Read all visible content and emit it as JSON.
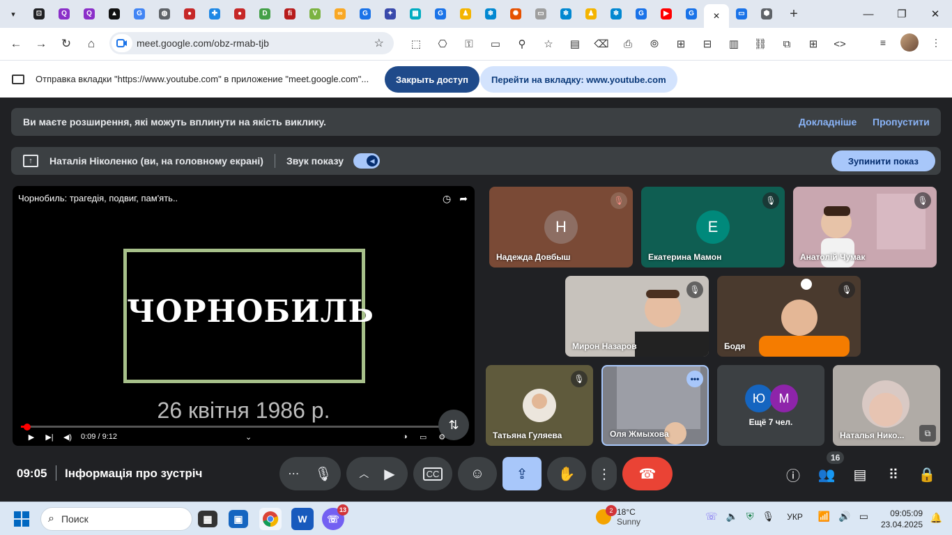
{
  "browser": {
    "tabs": [
      {
        "icon": "google-meet-icon",
        "glyph": "⊡",
        "color": "#202124"
      },
      {
        "icon": "q-icon",
        "glyph": "Q",
        "color": "#8b2fc9"
      },
      {
        "icon": "q-icon",
        "glyph": "Q",
        "color": "#8b2fc9"
      },
      {
        "icon": "delta-icon",
        "glyph": "▲",
        "color": "#111111"
      },
      {
        "icon": "google-icon",
        "glyph": "G",
        "color": "#4285f4"
      },
      {
        "icon": "globe-icon",
        "glyph": "◍",
        "color": "#5f6368"
      },
      {
        "icon": "red-ball-icon",
        "glyph": "●",
        "color": "#c62828"
      },
      {
        "icon": "puzzle-icon",
        "glyph": "✚",
        "color": "#1e88e5"
      },
      {
        "icon": "red-ball-icon",
        "glyph": "●",
        "color": "#c62828"
      },
      {
        "icon": "d-icon",
        "glyph": "D",
        "color": "#43a047"
      },
      {
        "icon": "fi-icon",
        "glyph": "fi",
        "color": "#b71c1c"
      },
      {
        "icon": "ve-icon",
        "glyph": "V",
        "color": "#7cb342"
      },
      {
        "icon": "link-icon",
        "glyph": "∞",
        "color": "#f9a825"
      },
      {
        "icon": "gsuite-icon",
        "glyph": "G",
        "color": "#1a73e8"
      },
      {
        "icon": "badge-icon",
        "glyph": "✦",
        "color": "#3949ab"
      },
      {
        "icon": "grid-icon",
        "glyph": "▦",
        "color": "#00acc1"
      },
      {
        "icon": "gsuite-icon",
        "glyph": "G",
        "color": "#1a73e8"
      },
      {
        "icon": "bell-icon",
        "glyph": "♟",
        "color": "#f4b400"
      },
      {
        "icon": "snowflake-icon",
        "glyph": "❄",
        "color": "#0288d1"
      },
      {
        "icon": "pinwheel-icon",
        "glyph": "✺",
        "color": "#e65100"
      },
      {
        "icon": "board-icon",
        "glyph": "▭",
        "color": "#9e9e9e"
      },
      {
        "icon": "snowflake-icon",
        "glyph": "❄",
        "color": "#0288d1"
      },
      {
        "icon": "bell-icon",
        "glyph": "♟",
        "color": "#f4b400"
      },
      {
        "icon": "snowflake-icon",
        "glyph": "❄",
        "color": "#0288d1"
      },
      {
        "icon": "gsuite-icon",
        "glyph": "G",
        "color": "#1a73e8"
      },
      {
        "icon": "youtube-icon",
        "glyph": "▶",
        "color": "#ff0000"
      },
      {
        "icon": "gsuite-icon",
        "glyph": "G",
        "color": "#1a73e8"
      }
    ],
    "active_tab_close": "✕",
    "after_tabs": [
      {
        "icon": "screen-icon",
        "glyph": "▭",
        "color": "#1a73e8"
      },
      {
        "icon": "shield-icon",
        "glyph": "⬢",
        "color": "#5f6368"
      }
    ],
    "new_tab": "+",
    "window_controls": {
      "minimize": "—",
      "maximize": "❐",
      "close": "✕"
    },
    "url": "meet.google.com/obz-rmab-tjb",
    "extensions": [
      "⬚",
      "⎔",
      "⚿",
      "▭",
      "⚲",
      "☆",
      "▤",
      "⌫",
      "⎙",
      "⦾",
      "⊞",
      "⊟",
      "▥",
      "⛓",
      "⧉",
      "⊞",
      "<>"
    ]
  },
  "infobar": {
    "text": "Отправка вкладки \"https://www.youtube.com\" в приложение \"meet.google.com\"...",
    "close_access": "Закрыть доступ",
    "go_to_tab": "Перейти на вкладку: www.youtube.com"
  },
  "meet": {
    "banner": {
      "text": "Ви маєте розширення, які можуть вплинути на якість виклику.",
      "more": "Докладніше",
      "skip": "Пропустити"
    },
    "presenting": {
      "name": "Наталія Ніколенко (ви, на головному екрані)",
      "sound": "Звук показу",
      "stop": "Зупинити показ"
    },
    "video": {
      "title": "Чорнобиль: трагедія, подвиг, пам'ять..",
      "big_title": "ЧОРНОБИЛЬ",
      "date": "26 квітня 1986 р.",
      "time": "0:09 / 9:12",
      "progress": 0.016
    },
    "participants": [
      {
        "name": "Надежда Довбыш",
        "initial": "Н",
        "avatar_color": "#8d6e63",
        "bg": "#7a4a36",
        "muted": true
      },
      {
        "name": "Екатерина Мамон",
        "initial": "Е",
        "avatar_color": "#00897b",
        "bg": "#0f5e52",
        "muted": true
      },
      {
        "name": "Анатолій Чумак",
        "initial": "",
        "bg": "#c9a7b0",
        "muted": true
      },
      {
        "name": "Мирон Назаров",
        "initial": "",
        "bg": "#c7c2bc",
        "muted": true
      },
      {
        "name": "Бодя",
        "initial": "",
        "bg": "#4a3a2e",
        "muted": true
      },
      {
        "name": "Татьяна Гуляева",
        "initial": "",
        "bg": "#5f5a3c",
        "muted": true
      },
      {
        "name": "Оля Жмыхова",
        "initial": "",
        "bg": "#7e8087",
        "muted": false
      },
      {
        "name": "Наталья Нико...",
        "initial": "",
        "bg": "#b0aba6",
        "muted": false
      }
    ],
    "others": {
      "initials": [
        "Ю",
        "М"
      ],
      "colors": [
        "#1565c0",
        "#8e24aa"
      ],
      "label": "Ещё 7 чел."
    },
    "bottom": {
      "time": "09:05",
      "meeting_info": "Інформація про зустріч",
      "people_count": "16"
    }
  },
  "taskbar": {
    "search": "Поиск",
    "weather": {
      "temp": "18°C",
      "desc": "Sunny",
      "badge": "2"
    },
    "viber_badge": "13",
    "lang": "УКР",
    "time": "09:05:09",
    "date": "23.04.2025"
  }
}
